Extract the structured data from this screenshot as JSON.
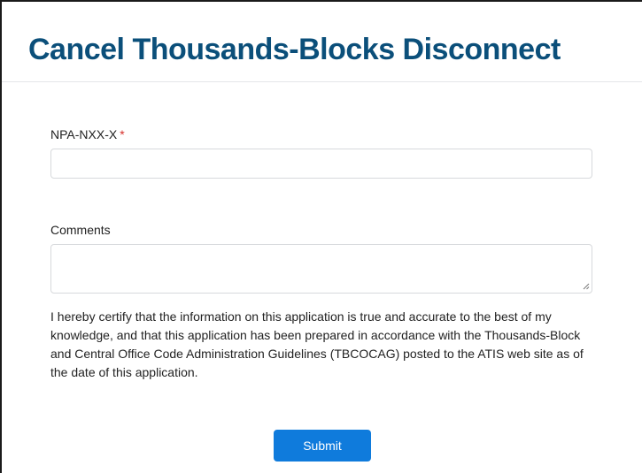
{
  "page": {
    "title": "Cancel Thousands-Blocks Disconnect"
  },
  "form": {
    "npa_field": {
      "label": "NPA-NXX-X",
      "required_marker": "*",
      "value": ""
    },
    "comments_field": {
      "label": "Comments",
      "value": ""
    },
    "certification_text": "I hereby certify that the information on this application is true and accurate to the best of my knowledge, and that this application has been prepared in accordance with the Thousands-Block and Central Office Code Administration Guidelines (TBCOCAG) posted to the ATIS web site as of the date of this application.",
    "submit_label": "Submit"
  },
  "colors": {
    "title": "#0b4f7a",
    "required": "#d6312b",
    "submit_bg": "#0f7bdc",
    "input_border": "#d7d9dc"
  },
  "icons": {
    "textarea_resize": "resize-grip-icon"
  }
}
